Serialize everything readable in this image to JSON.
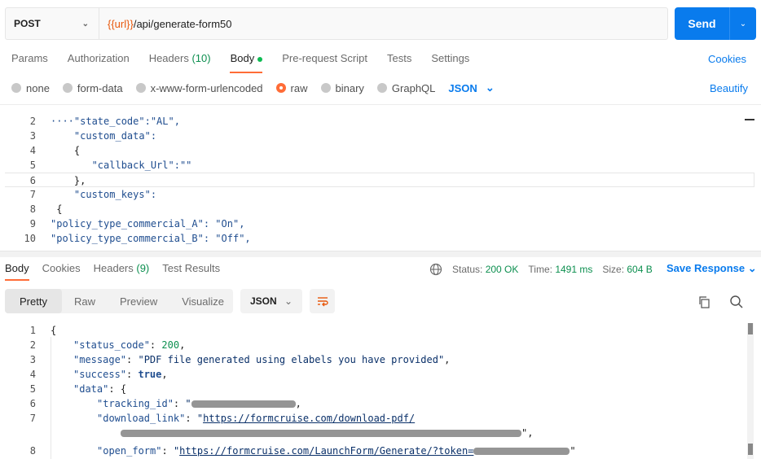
{
  "request": {
    "method": "POST",
    "url_variable": "{{url}}",
    "url_path": "/api/generate-form50",
    "send_label": "Send"
  },
  "request_tabs": [
    {
      "label": "Params"
    },
    {
      "label": "Authorization"
    },
    {
      "label": "Headers",
      "count": "(10)"
    },
    {
      "label": "Body"
    },
    {
      "label": "Pre-request Script"
    },
    {
      "label": "Tests"
    },
    {
      "label": "Settings"
    }
  ],
  "cookies_label": "Cookies",
  "body_types": {
    "none": "none",
    "form_data": "form-data",
    "urlencoded": "x-www-form-urlencoded",
    "raw": "raw",
    "binary": "binary",
    "graphql": "GraphQL",
    "format": "JSON",
    "beautify": "Beautify"
  },
  "editor_lines": [
    {
      "n": "2",
      "text": "····\"state_code\":\"AL\","
    },
    {
      "n": "3",
      "text": "    \"custom_data\":"
    },
    {
      "n": "4",
      "text": "    {"
    },
    {
      "n": "5",
      "text": "       \"callback_Url\":\"\""
    },
    {
      "n": "6",
      "text": "    },"
    },
    {
      "n": "7",
      "text": "    \"custom_keys\":"
    },
    {
      "n": "8",
      "text": " {"
    },
    {
      "n": "9",
      "text": "\"policy_type_commercial_A\": \"On\","
    },
    {
      "n": "10",
      "text": "\"policy_type_commercial_B\": \"Off\","
    }
  ],
  "response_tabs": [
    {
      "label": "Body"
    },
    {
      "label": "Cookies"
    },
    {
      "label": "Headers",
      "count": "(9)"
    },
    {
      "label": "Test Results"
    }
  ],
  "response_status": {
    "status_label": "Status:",
    "status_value": "200 OK",
    "time_label": "Time:",
    "time_value": "1491 ms",
    "size_label": "Size:",
    "size_value": "604 B",
    "save_response": "Save Response"
  },
  "view_modes": [
    "Pretty",
    "Raw",
    "Preview",
    "Visualize"
  ],
  "response_format": "JSON",
  "response_body": {
    "l1": {
      "n": "1",
      "text": "{"
    },
    "l2": {
      "n": "2",
      "key": "\"status_code\"",
      "value": "200"
    },
    "l3": {
      "n": "3",
      "key": "\"message\"",
      "value": "\"PDF file generated using elabels you have provided\""
    },
    "l4": {
      "n": "4",
      "key": "\"success\"",
      "value": "true"
    },
    "l5": {
      "n": "5",
      "key": "\"data\"",
      "value": "{"
    },
    "l6": {
      "n": "6",
      "key": "\"tracking_id\"",
      "value": "\""
    },
    "l7": {
      "n": "7",
      "key": "\"download_link\"",
      "value": "\"",
      "link": "https://formcruise.com/download-pdf/"
    },
    "l8": {
      "n": "8",
      "key": "\"open_form\"",
      "value": "\"",
      "link": "https://formcruise.com/LaunchForm/Generate/?token="
    }
  }
}
